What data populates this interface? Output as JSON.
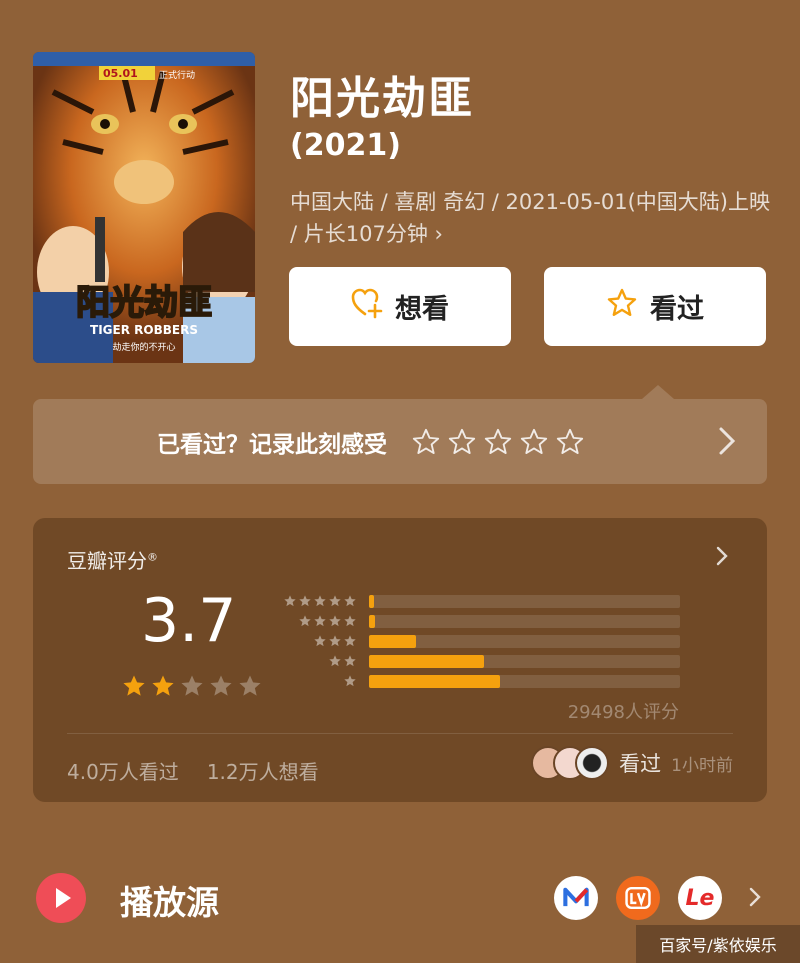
{
  "movie": {
    "title": "阳光劫匪",
    "year": "(2021)",
    "meta": "中国大陆 / 喜剧 奇幻 / 2021-05-01(中国大陆)上映 / 片长107分钟 ›"
  },
  "poster": {
    "main_title": "阳光劫匪",
    "subtitle": "TIGER ROBBERS",
    "tagline": "劫走你的不开心",
    "date_badge": "05.01",
    "date_suffix": "正式行动"
  },
  "actions": {
    "want_label": "想看",
    "seen_label": "看过"
  },
  "record": {
    "text": "已看过？记录此刻感受"
  },
  "rating": {
    "label": "豆瓣评分",
    "label_mark": "®",
    "score": "3.7",
    "filled_stars": 2,
    "distribution": [
      {
        "stars": 5,
        "fraction": 0.015
      },
      {
        "stars": 4,
        "fraction": 0.02
      },
      {
        "stars": 3,
        "fraction": 0.15
      },
      {
        "stars": 2,
        "fraction": 0.37
      },
      {
        "stars": 1,
        "fraction": 0.42
      }
    ],
    "count": "29498人评分",
    "watched": "4.0万人看过",
    "wants": "1.2万人想看",
    "friends_action": "看过",
    "friends_time": "1小时前"
  },
  "play": {
    "label": "播放源",
    "platforms": [
      "M",
      "LV",
      "Le"
    ]
  },
  "watermark": "百家号/紫依娱乐",
  "colors": {
    "background": "#8f6138",
    "accent": "#f5a10e",
    "play_red": "#ef4d57"
  }
}
